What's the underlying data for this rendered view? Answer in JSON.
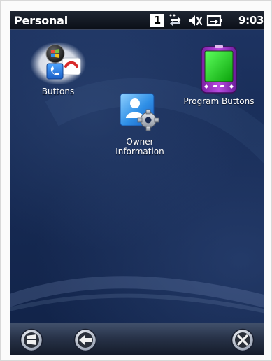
{
  "status_bar": {
    "title": "Personal",
    "badge": "1",
    "time": "9:03",
    "icons": [
      "connectivity-icon",
      "speaker-muted-icon",
      "battery-charging-icon"
    ]
  },
  "desktop": {
    "apps": [
      {
        "label": "Buttons",
        "icon": "buttons-phone-icon"
      },
      {
        "label_line1": "Owner",
        "label_line2": "Information",
        "icon": "owner-information-icon"
      },
      {
        "label": "Program Buttons",
        "icon": "program-buttons-device-icon"
      }
    ]
  },
  "taskbar": {
    "items": [
      "start-windows-icon",
      "back-arrow-icon",
      "close-x-icon"
    ]
  }
}
